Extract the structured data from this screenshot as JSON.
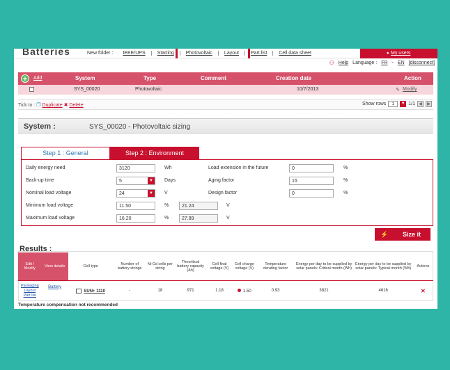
{
  "nav": {
    "logo": "Batteries",
    "new_folder_label": "New folder :",
    "links": [
      "IEEE/UPS",
      "Starting",
      "Photovoltaic",
      "Layout",
      "Part list",
      "Cell data sheet"
    ],
    "my_users": "My users",
    "help": "Help",
    "language_label": "Language :",
    "lang_fr": "FR",
    "lang_en": "EN",
    "disconnect": "[disconnect]"
  },
  "systems": {
    "add": "Add",
    "headers": {
      "system": "System",
      "type": "Type",
      "comment": "Comment",
      "creation_date": "Creation date",
      "action": "Action"
    },
    "row": {
      "system": "SYS_00020",
      "type": "Photovoltaic",
      "comment": "",
      "date": "10/7/2013",
      "action": "Modify"
    }
  },
  "toolbar": {
    "tick_to": "Tick to :",
    "duplicate": "Duplicate",
    "delete": "Delete",
    "show_rows": "Show rows",
    "rows_value": "1",
    "pages": "1/1"
  },
  "system_header": {
    "label": "System :",
    "title": "SYS_00020 - Photovoltaic sizing"
  },
  "steps": {
    "step1": "Step 1 : General",
    "step2": "Step 2 : Environment"
  },
  "form": {
    "daily_energy": {
      "label": "Daily energy need",
      "value": "3120",
      "unit": "Wh"
    },
    "backup_time": {
      "label": "Back-up time",
      "value": "5",
      "unit": "Days"
    },
    "nominal_voltage": {
      "label": "Nominal load voltage",
      "value": "24",
      "unit": "V"
    },
    "min_voltage": {
      "label": "Minimum load voltage",
      "value": "11.50",
      "unit": "%",
      "value2": "21.24",
      "unit2": "V"
    },
    "max_voltage": {
      "label": "Maximum load voltage",
      "value": "16.20",
      "unit": "%",
      "value2": "27.89",
      "unit2": "V"
    },
    "load_extension": {
      "label": "Load extension in the future",
      "value": "0",
      "unit": "%"
    },
    "aging_factor": {
      "label": "Aging factor",
      "value": "15",
      "unit": "%"
    },
    "design_factor": {
      "label": "Design factor",
      "value": "0",
      "unit": "%"
    }
  },
  "size_button": "Size it",
  "results": {
    "title": "Results :",
    "headers": [
      "Edit / Modify",
      "View details",
      "Cell type",
      "Number of battery strings",
      "Ni-Cd cells per string",
      "Theoritical battery capacity (Ah)",
      "Cell final voltage (V)",
      "Cell charge voltage (V)",
      "Temperature derating factor",
      "Energy per day to be supplied by solar panels: Critical month (Wh)",
      "Energy per day to be supplied by solar panels: Typical month (Wh)",
      "Actions"
    ],
    "row": {
      "edit_links": [
        "Packaging",
        "Layout",
        "Part list"
      ],
      "view_link": "Battery",
      "cell_type": "SUN+ 1110",
      "strings": "-",
      "cells": "18",
      "capacity": "971",
      "final_voltage": "1.18",
      "charge_voltage": "1.50",
      "derating": "0.93",
      "critical": "3821",
      "typical": "4616"
    },
    "warning": "Temperature compensation not recommended"
  }
}
